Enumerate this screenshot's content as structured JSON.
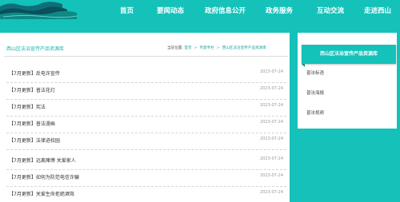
{
  "nav": {
    "items": [
      {
        "label": "首页"
      },
      {
        "label": "要闻动态"
      },
      {
        "label": "政府信息公开"
      },
      {
        "label": "政务服务"
      },
      {
        "label": "互动交流"
      },
      {
        "label": "走进西山"
      }
    ]
  },
  "main": {
    "title": "西山区法治宣传产品资源库",
    "breadcrumb": {
      "prefix": "当前位置:",
      "links": [
        "首页",
        "专题专栏",
        "西山区法治宣传产品资源库"
      ],
      "separator": ">"
    },
    "articles": [
      {
        "title": "【7月更新】反电诈宣传",
        "date": "2023-07-24"
      },
      {
        "title": "【7月更新】普法花灯",
        "date": "2023-07-24"
      },
      {
        "title": "【7月更新】宪法",
        "date": "2023-07-24"
      },
      {
        "title": "【7月更新】普法漫画",
        "date": "2023-07-24"
      },
      {
        "title": "【7月更新】法律进校园",
        "date": "2023-07-24"
      },
      {
        "title": "【7月更新】远离赌博 关爱家人",
        "date": "2023-07-24"
      },
      {
        "title": "【7月更新】如何为防范电信诈骗",
        "date": "2023-07-24"
      },
      {
        "title": "【7月更新】关爱生命拒绝酒驾",
        "date": "2023-07-24"
      }
    ]
  },
  "sidebar": {
    "header": "西山区法治宣传产品资源库",
    "links": [
      {
        "label": "普法标语"
      },
      {
        "label": "普法海报"
      },
      {
        "label": "普法视频"
      }
    ]
  },
  "colors": {
    "accent": "#14c2ba",
    "title_text": "#17b5ad",
    "link_text": "#1aa7a0"
  }
}
